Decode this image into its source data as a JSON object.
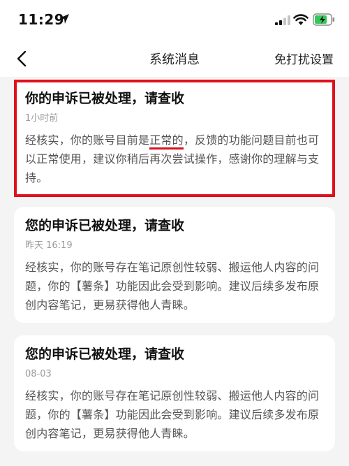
{
  "status_bar": {
    "time": "11:29"
  },
  "nav": {
    "title": "系统消息",
    "action": "免打扰设置"
  },
  "messages": [
    {
      "title": "你的申诉已被处理，请查收",
      "time": "1小时前",
      "body_pre": "经核实，你的账号目前是",
      "body_underline": "正常的",
      "body_post": "，反馈的功能问题目前也可以正常使用，建议你稍后再次尝试操作，感谢你的理解与支持。"
    },
    {
      "title": "您的申诉已被处理，请查收",
      "time": "昨天 16:19",
      "body": "经核实，你的账号存在笔记原创性较弱、搬运他人内容的问题，你的【薯条】功能因此会受到影响。建议后续多发布原创内容笔记，更易获得他人青睐。"
    },
    {
      "title": "您的申诉已被处理，请查收",
      "time": "08-03",
      "body": "经核实，你的账号存在笔记原创性较弱、搬运他人内容的问题，你的【薯条】功能因此会受到影响。建议后续多发布原创内容笔记，更易获得他人青睐。"
    }
  ],
  "colors": {
    "highlight_border": "#e0101c",
    "underline": "#d51220",
    "battery_fill": "#34c759"
  }
}
